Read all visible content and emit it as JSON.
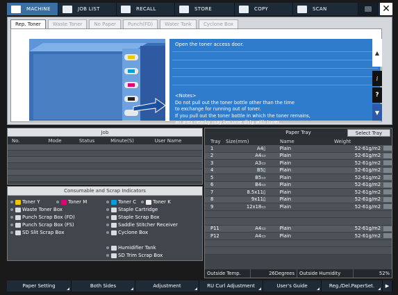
{
  "top_menu": [
    {
      "label": "MACHINE",
      "icon": "machine-icon",
      "active": true
    },
    {
      "label": "JOB LIST",
      "icon": "job-list-icon"
    },
    {
      "label": "RECALL",
      "icon": "recall-icon"
    },
    {
      "label": "STORE",
      "icon": "store-icon"
    },
    {
      "label": "COPY",
      "icon": "copy-icon"
    },
    {
      "label": "SCAN",
      "icon": "scan-icon"
    }
  ],
  "close_symbol": "✕",
  "tabs": [
    "Rep. Toner",
    "Waste Toner",
    "No Paper",
    "Punch(FD)",
    "Water Tank",
    "Cyclone Box"
  ],
  "message": {
    "instruction": "Open the toner access door.",
    "notes_title": "<Notes>",
    "notes": [
      "Do not pull out the toner bottle other than the time",
      "to exchange for running out of toner.",
      "If you pull out the toner bottle in which the toner remains,",
      "an area nearby may become dirty with toner."
    ]
  },
  "side_controls": {
    "up": "▲",
    "info": "i",
    "help": "?",
    "down": "▼"
  },
  "job": {
    "title": "Job",
    "columns": [
      "No.",
      "Mode",
      "Status",
      "Minute(S)",
      "User Name"
    ]
  },
  "consumables": {
    "title": "Consumable and Scrap Indicators",
    "items_left": [
      "Toner Y",
      "Waste Toner Box",
      "Punch Scrap Box (FD)",
      "Punch Scrap Box (FS)",
      "SD Slit Scrap Box"
    ],
    "toner_m": "Toner M",
    "toner_c": "Toner C",
    "toner_k": "Toner K",
    "items_right": [
      "Staple Cartridge",
      "Staple Scrap Box",
      "Saddle Stitcher Receiver",
      "Cyclone Box",
      "Humidifier Tank",
      "SD Trim Scrap Box"
    ]
  },
  "paper_tray": {
    "title": "Paper Tray",
    "select_button": "Select Tray",
    "columns": [
      "Tray",
      "Size(mm)",
      "Name",
      "Weight"
    ],
    "rows": [
      {
        "tray": "1",
        "size": "A4▯",
        "name": "Plain",
        "weight": "52-61g/m2"
      },
      {
        "tray": "2",
        "size": "A4▭",
        "name": "Plain",
        "weight": "52-61g/m2"
      },
      {
        "tray": "3",
        "size": "A3▭",
        "name": "Plain",
        "weight": "52-61g/m2"
      },
      {
        "tray": "4",
        "size": "B5▯",
        "name": "Plain",
        "weight": "52-61g/m2"
      },
      {
        "tray": "5",
        "size": "B5▭",
        "name": "Plain",
        "weight": "52-61g/m2"
      },
      {
        "tray": "6",
        "size": "B4▭",
        "name": "Plain",
        "weight": "52-61g/m2"
      },
      {
        "tray": "7",
        "size": "8.5x11▯",
        "name": "Plain",
        "weight": "52-61g/m2"
      },
      {
        "tray": "8",
        "size": "9x11▯",
        "name": "Plain",
        "weight": "52-61g/m2"
      },
      {
        "tray": "9",
        "size": "12x18▭",
        "name": "Plain",
        "weight": "52-61g/m2"
      },
      {
        "tray": "P11",
        "size": "A4▭",
        "name": "Plain",
        "weight": "52-61g/m2"
      },
      {
        "tray": "P12",
        "size": "A4▭",
        "name": "Plain",
        "weight": "52-61g/m2"
      }
    ],
    "outside_temp_label": "Outside Temp.",
    "outside_temp_value": "26Degrees",
    "outside_humidity_label": "Outside Humidity",
    "outside_humidity_value": "52%"
  },
  "bottom_bar": [
    "Paper Setting",
    "Both Sides",
    "Adjustment",
    "RU Curl Adjustment",
    "User's Guide",
    "Reg./Del.PaperSet.",
    "▶"
  ]
}
